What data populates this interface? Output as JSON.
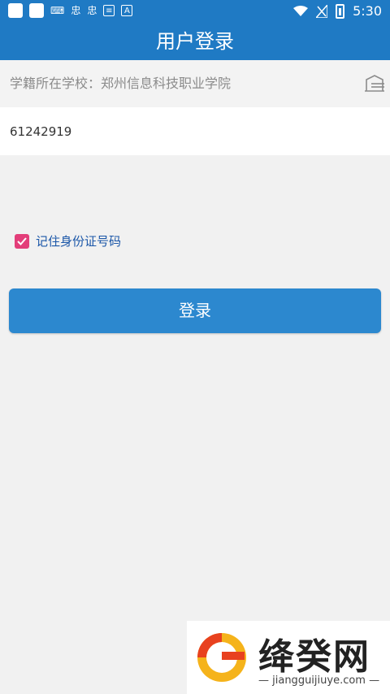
{
  "status_bar": {
    "time": "5:30",
    "left_icons": [
      "square",
      "square",
      "keyboard-icon",
      "app-icon",
      "app-icon",
      "message-icon",
      "font-icon"
    ],
    "right_icons": [
      "wifi-icon",
      "no-signal-icon",
      "battery-icon"
    ],
    "app_glyph": "忠",
    "a_label": "A"
  },
  "app_bar": {
    "title": "用户登录"
  },
  "form": {
    "school_label": "学籍所在学校：郑州信息科技职业学院",
    "id_value": "61242919",
    "remember_label": "记住身份证号码",
    "remember_checked": true,
    "login_label": "登录"
  },
  "watermark": {
    "title": "绛癸网",
    "subtitle": "— jiangguijiuye.com —"
  },
  "colors": {
    "primary": "#1f7ac4",
    "button": "#2c88cf",
    "checkbox": "#e33e7a",
    "background": "#f1f1f1"
  }
}
